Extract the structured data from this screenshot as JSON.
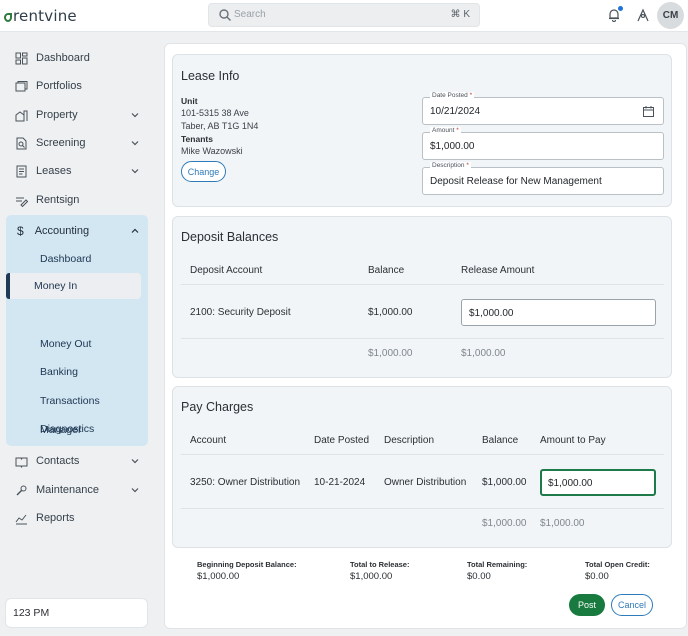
{
  "app": {
    "logo": "rentvine"
  },
  "topbar": {
    "search_placeholder": "Search",
    "shortcut": "⌘ K",
    "avatar_initials": "CM",
    "icons": [
      "search-icon",
      "bell-icon",
      "profile-icon"
    ],
    "notification_dot_color": "#1e73d8"
  },
  "sidebar": {
    "items": [
      {
        "label": "Dashboard",
        "icon": "dashboard-icon"
      },
      {
        "label": "Portfolios",
        "icon": "portfolio-icon"
      },
      {
        "label": "Property",
        "icon": "property-icon"
      },
      {
        "label": "Screening",
        "icon": "screening-icon"
      },
      {
        "label": "Leases",
        "icon": "leases-icon"
      },
      {
        "label": "Rentsign",
        "icon": "rentsign-icon"
      }
    ],
    "accounting": {
      "label": "Accounting",
      "icon_glyph": "$",
      "subitems": [
        "Dashboard",
        "Money In",
        "Money Out",
        "Banking",
        "Transactions",
        "Diagnostics",
        "Manager"
      ],
      "active": "Money In"
    },
    "items_after": [
      {
        "label": "Contacts",
        "icon": "contacts-icon"
      },
      {
        "label": "Maintenance",
        "icon": "maintenance-icon"
      },
      {
        "label": "Reports",
        "icon": "reports-icon"
      }
    ],
    "clock": "123 PM"
  },
  "lease_info": {
    "title": "Lease Info",
    "unit_label": "Unit",
    "unit_line1": "101-5315 38 Ave",
    "unit_line2": "Taber, AB T1G 1N4",
    "tenants_label": "Tenants",
    "tenant_name": "Mike Wazowski",
    "change_button": "Change",
    "date_label": "Date Posted",
    "date_value": "10/21/2024",
    "amount_label": "Amount",
    "amount_value": "$1,000.00",
    "description_label": "Description",
    "description_value": "Deposit Release for New Management",
    "required_mark": "*"
  },
  "deposit_balances": {
    "title": "Deposit Balances",
    "headers": [
      "Deposit Account",
      "Balance",
      "Release Amount"
    ],
    "rows": [
      {
        "account": "2100: Security Deposit",
        "balance": "$1,000.00",
        "release": "$1,000.00"
      }
    ],
    "totals": {
      "balance": "$1,000.00",
      "release": "$1,000.00"
    }
  },
  "pay_charges": {
    "title": "Pay Charges",
    "headers": [
      "Account",
      "Date Posted",
      "Description",
      "Balance",
      "Amount to Pay"
    ],
    "rows": [
      {
        "account": "3250: Owner Distribution",
        "date": "10-21-2024",
        "description": "Owner Distribution",
        "balance": "$1,000.00",
        "amount": "$1,000.00"
      }
    ],
    "totals": {
      "balance": "$1,000.00",
      "amount": "$1,000.00"
    }
  },
  "summary": {
    "beginning_label": "Beginning Deposit Balance:",
    "beginning_value": "$1,000.00",
    "release_label": "Total to Release:",
    "release_value": "$1,000.00",
    "remaining_label": "Total Remaining:",
    "remaining_value": "$0.00",
    "credit_label": "Total Open Credit:",
    "credit_value": "$0.00"
  },
  "actions": {
    "post": "Post",
    "cancel": "Cancel"
  },
  "colors": {
    "accent_green": "#187a3f",
    "link_blue": "#2f7ab8",
    "sidebar_group": "#d3e7f3"
  }
}
